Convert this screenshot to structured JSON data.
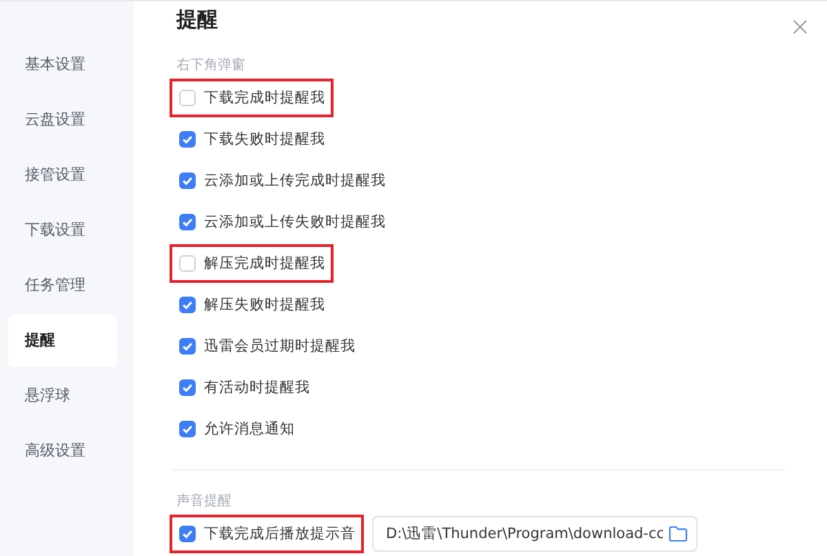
{
  "sidebar": {
    "items": [
      {
        "label": "基本设置",
        "selected": false
      },
      {
        "label": "云盘设置",
        "selected": false
      },
      {
        "label": "接管设置",
        "selected": false
      },
      {
        "label": "下载设置",
        "selected": false
      },
      {
        "label": "任务管理",
        "selected": false
      },
      {
        "label": "提醒",
        "selected": true
      },
      {
        "label": "悬浮球",
        "selected": false
      },
      {
        "label": "高级设置",
        "selected": false
      }
    ]
  },
  "title": "提醒",
  "sections": [
    {
      "label": "右下角弹窗",
      "options": [
        {
          "label": "下载完成时提醒我",
          "checked": false,
          "highlighted": true
        },
        {
          "label": "下载失败时提醒我",
          "checked": true,
          "highlighted": false
        },
        {
          "label": "云添加或上传完成时提醒我",
          "checked": true,
          "highlighted": false
        },
        {
          "label": "云添加或上传失败时提醒我",
          "checked": true,
          "highlighted": false
        },
        {
          "label": "解压完成时提醒我",
          "checked": false,
          "highlighted": true
        },
        {
          "label": "解压失败时提醒我",
          "checked": true,
          "highlighted": false
        },
        {
          "label": "迅雷会员过期时提醒我",
          "checked": true,
          "highlighted": false
        },
        {
          "label": "有活动时提醒我",
          "checked": true,
          "highlighted": false
        },
        {
          "label": "允许消息通知",
          "checked": true,
          "highlighted": false
        }
      ]
    },
    {
      "label": "声音提醒",
      "options": [
        {
          "label": "下载完成后播放提示音",
          "checked": true,
          "highlighted": true,
          "path": "D:\\迅雷\\Thunder\\Program\\download-cc"
        }
      ]
    }
  ]
}
